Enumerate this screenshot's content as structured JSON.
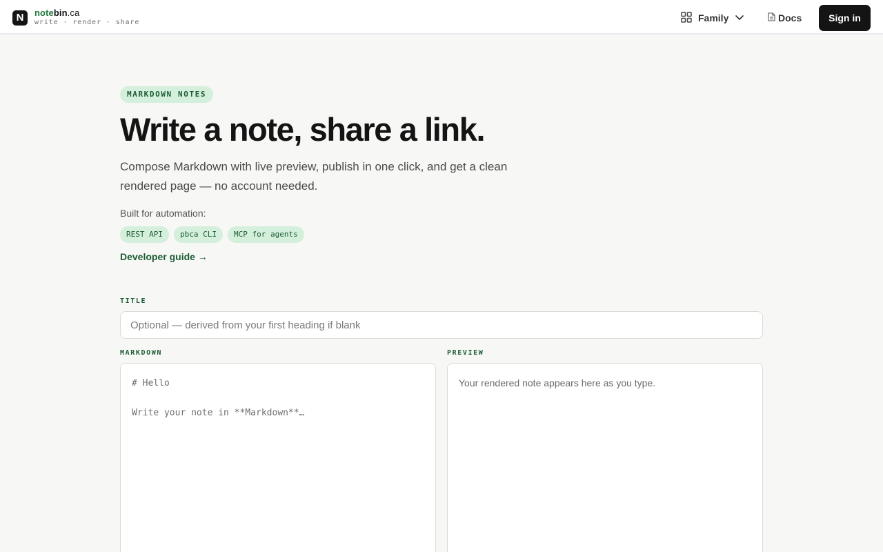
{
  "header": {
    "brand_logo_letter": "N",
    "brand_name_part1": "note",
    "brand_name_part2": "bin",
    "brand_name_part3": ".ca",
    "brand_tagline": "write · render · share",
    "family_label": "Family",
    "docs_label": "Docs",
    "signin_label": "Sign in"
  },
  "hero": {
    "pill": "MARKDOWN NOTES",
    "title": "Write a note, share a link.",
    "subtitle": "Compose Markdown with live preview, publish in one click, and get a clean rendered page — no account needed.",
    "automation_label": "Built for automation:",
    "chips": [
      "REST API",
      "pbca CLI",
      "MCP for agents"
    ],
    "developer_link": "Developer guide →"
  },
  "form": {
    "title_label": "TITLE",
    "title_placeholder": "Optional — derived from your first heading if blank",
    "markdown_label": "MARKDOWN",
    "markdown_placeholder": "# Hello\n\nWrite your note in **Markdown**…",
    "preview_label": "PREVIEW",
    "preview_placeholder": "Your rendered note appears here as you type."
  },
  "icons": {
    "brand": "notebin-logo-icon",
    "family": "grid-apps-icon",
    "family_chevron": "chevron-down-icon",
    "docs": "document-icon"
  },
  "colors": {
    "accent_green": "#1d5c34",
    "chip_bg": "#d4efdc",
    "dark": "#141414",
    "page_bg": "#f7f7f5"
  }
}
